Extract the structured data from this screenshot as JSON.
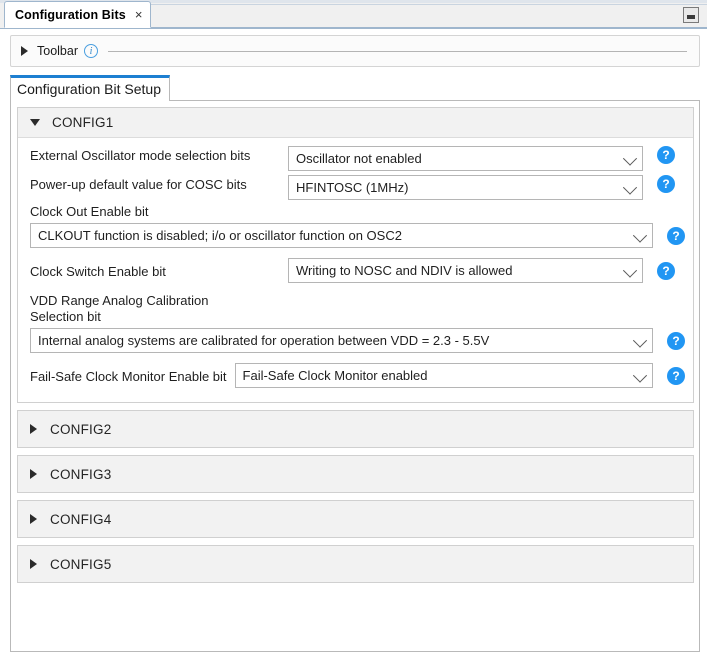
{
  "window": {
    "doc_tab_title": "Configuration Bits",
    "doc_tab_close": "×",
    "minimize_label": "",
    "accent_color": "#1d7fd1",
    "help_icon_color": "#2196f3"
  },
  "toolbar": {
    "expand_icon": "triangle-right",
    "label": "Toolbar",
    "info_icon": "i"
  },
  "inner_tabs": [
    {
      "label": "Configuration Bit Setup",
      "selected": true
    }
  ],
  "sections": [
    {
      "id": "CONFIG1",
      "title": "CONFIG1",
      "expanded": true,
      "rows": [
        {
          "layout": "label-left",
          "label": "External Oscillator mode selection bits",
          "value": "Oscillator not enabled",
          "help": "?"
        },
        {
          "layout": "label-left",
          "label": "Power-up default value for COSC bits",
          "value": "HFINTOSC (1MHz)",
          "help": "?"
        },
        {
          "layout": "label-above",
          "label": "Clock Out Enable bit",
          "value": "CLKOUT function is disabled; i/o or oscillator function on OSC2",
          "help": "?"
        },
        {
          "layout": "label-left",
          "label": "Clock Switch Enable bit",
          "value": "Writing to NOSC and NDIV is allowed",
          "help": "?"
        },
        {
          "layout": "label-above",
          "label": "VDD Range Analog Calibration Selection bit",
          "value": "Internal analog systems are calibrated for operation between VDD = 2.3 - 5.5V",
          "help": "?"
        },
        {
          "layout": "label-left-auto",
          "label": "Fail-Safe Clock Monitor Enable bit",
          "value": "Fail-Safe Clock Monitor enabled",
          "help": "?"
        }
      ]
    },
    {
      "id": "CONFIG2",
      "title": "CONFIG2",
      "expanded": false
    },
    {
      "id": "CONFIG3",
      "title": "CONFIG3",
      "expanded": false
    },
    {
      "id": "CONFIG4",
      "title": "CONFIG4",
      "expanded": false
    },
    {
      "id": "CONFIG5",
      "title": "CONFIG5",
      "expanded": false
    }
  ]
}
